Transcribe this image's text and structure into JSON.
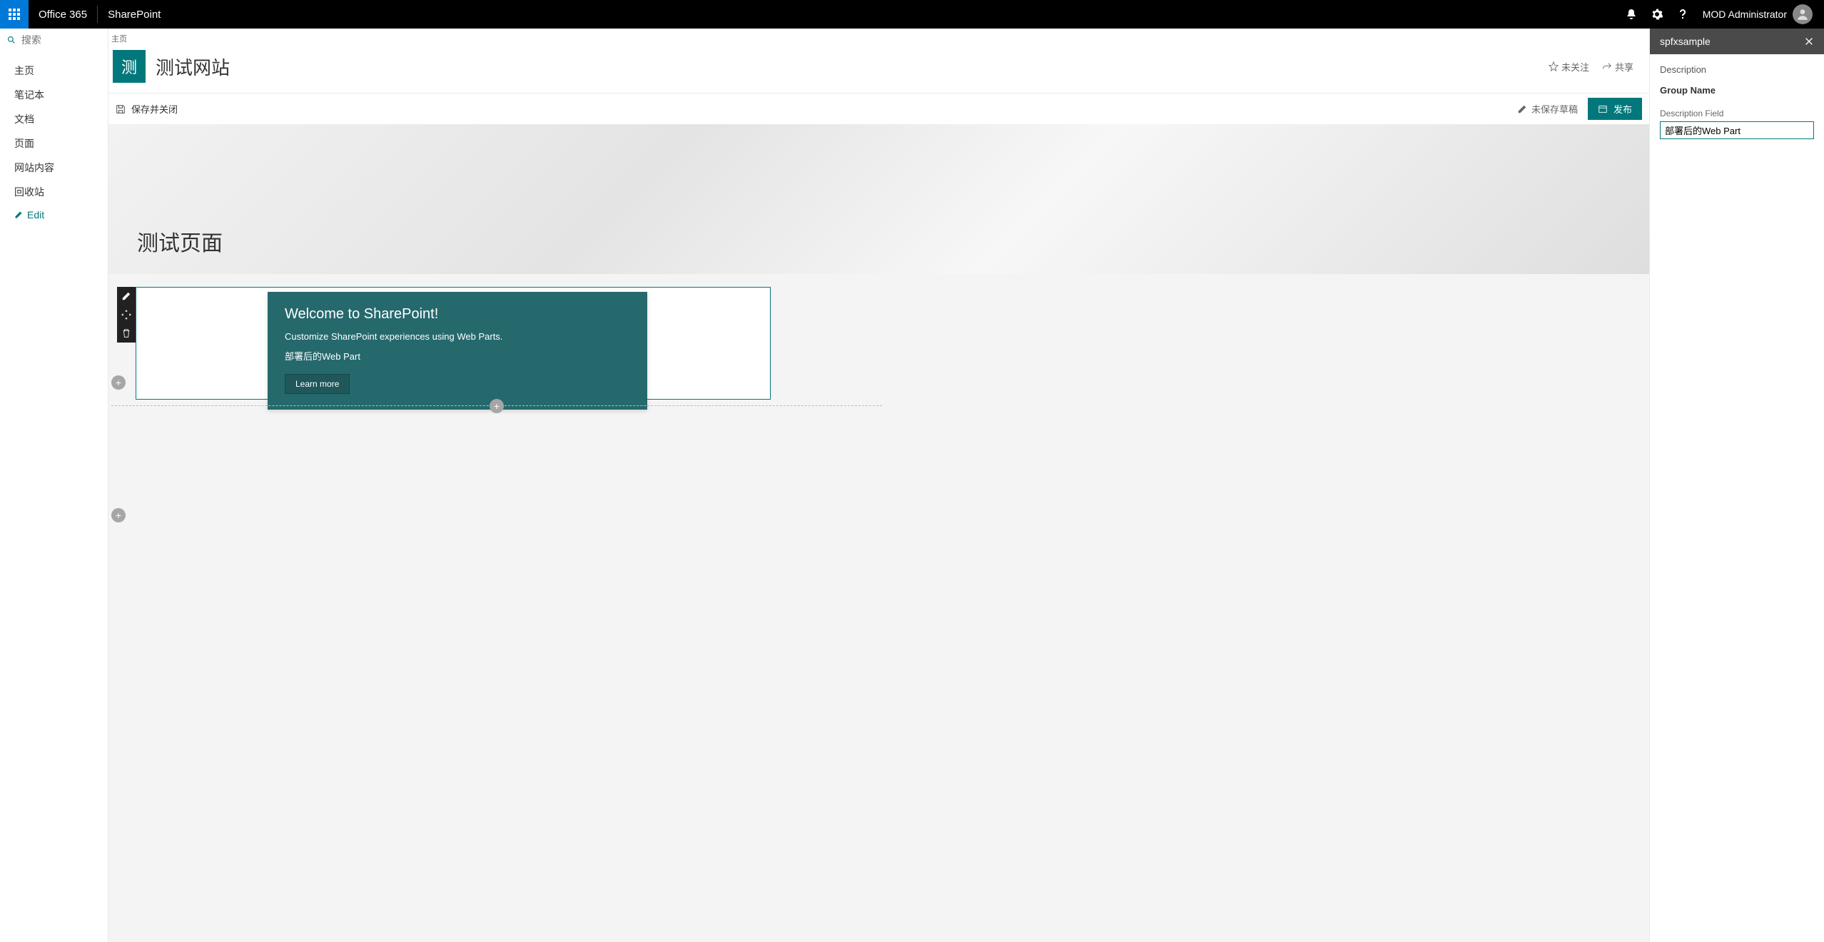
{
  "topbar": {
    "office": "Office 365",
    "app": "SharePoint",
    "user": "MOD Administrator"
  },
  "search": {
    "placeholder": "搜索"
  },
  "nav": {
    "items": [
      "主页",
      "笔记本",
      "文档",
      "页面",
      "网站内容",
      "回收站"
    ],
    "edit": "Edit"
  },
  "breadcrumb": "主页",
  "site": {
    "logo": "测",
    "title": "测试网站",
    "follow": "未关注",
    "share": "共享"
  },
  "cmdbar": {
    "saveClose": "保存并关闭",
    "draft": "未保存草稿",
    "publish": "发布"
  },
  "hero": {
    "title": "测试页面"
  },
  "webpart": {
    "heading": "Welcome to SharePoint!",
    "sub": "Customize SharePoint experiences using Web Parts.",
    "desc": "部署后的Web Part",
    "learn": "Learn more"
  },
  "pane": {
    "title": "spfxsample",
    "descLabel": "Description",
    "groupLabel": "Group Name",
    "fieldLabel": "Description Field",
    "fieldValue": "部署后的Web Part"
  }
}
